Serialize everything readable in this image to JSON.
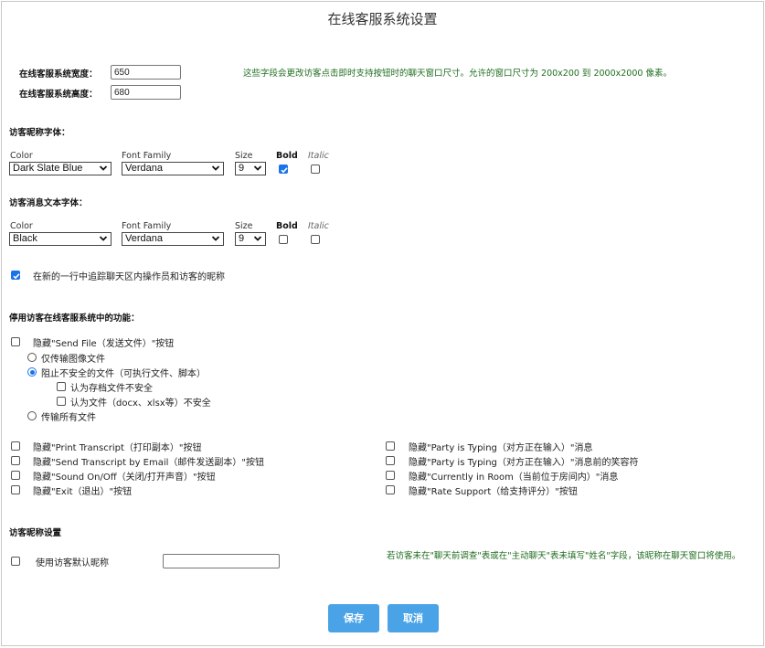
{
  "page": {
    "title": "在线客服系统设置"
  },
  "window_size": {
    "width_label": "在线客服系统宽度：",
    "width_value": "650",
    "height_label": "在线客服系统高度：",
    "height_value": "680",
    "hint": "这些字段会更改访客点击即时支持按钮时的聊天窗口尺寸。允许的窗口尺寸为 200x200 到 2000x2000 像素。"
  },
  "nickname_font": {
    "heading": "访客昵称字体：",
    "color_label": "Color",
    "color_value": "Dark Slate Blue",
    "family_label": "Font Family",
    "family_value": "Verdana",
    "size_label": "Size",
    "size_value": "9",
    "bold_label": "Bold",
    "bold_checked": true,
    "italic_label": "Italic",
    "italic_checked": false
  },
  "message_font": {
    "heading": "访客消息文本字体：",
    "color_label": "Color",
    "color_value": "Black",
    "family_label": "Font Family",
    "family_value": "Verdana",
    "size_label": "Size",
    "size_value": "9",
    "bold_label": "Bold",
    "bold_checked": false,
    "italic_label": "Italic",
    "italic_checked": false
  },
  "track_nicknames": {
    "label": "在新的一行中追踪聊天区内操作员和访客的昵称",
    "checked": true
  },
  "disable_features": {
    "heading": "停用访客在线客服系统中的功能：",
    "send_file": {
      "label": "隐藏\"Send File（发送文件）\"按钮",
      "checked": false,
      "options": [
        {
          "label": "仅传输图像文件",
          "selected": false
        },
        {
          "label": "阻止不安全的文件（可执行文件、脚本）",
          "selected": true
        },
        {
          "label": "传输所有文件",
          "selected": false
        }
      ],
      "sub_options": [
        {
          "label": "认为存档文件不安全",
          "checked": false
        },
        {
          "label": "认为文件（docx、xlsx等）不安全",
          "checked": false
        }
      ]
    },
    "left_items": [
      {
        "label": "隐藏\"Print Transcript（打印副本）\"按钮",
        "checked": false
      },
      {
        "label": "隐藏\"Send Transcript by Email（邮件发送副本）\"按钮",
        "checked": false
      },
      {
        "label": "隐藏\"Sound On/Off（关闭/打开声音）\"按钮",
        "checked": false
      },
      {
        "label": "隐藏\"Exit（退出）\"按钮",
        "checked": false
      }
    ],
    "right_items": [
      {
        "label": "隐藏\"Party is Typing（对方正在输入）\"消息",
        "checked": false
      },
      {
        "label": "隐藏\"Party is Typing（对方正在输入）\"消息前的笑容符",
        "checked": false
      },
      {
        "label": "隐藏\"Currently in Room（当前位于房间内）\"消息",
        "checked": false
      },
      {
        "label": "隐藏\"Rate Support（给支持评分）\"按钮",
        "checked": false
      }
    ]
  },
  "nickname_settings": {
    "heading": "访客昵称设置",
    "default_label": "使用访客默认昵称",
    "default_checked": false,
    "default_value": "",
    "hint": "若访客未在\"聊天前调查\"表或在\"主动聊天\"表未填写\"姓名\"字段，该昵称在聊天窗口将使用。"
  },
  "actions": {
    "save_label": "保存",
    "cancel_label": "取消"
  },
  "colors": {
    "accent": "#1a73e8",
    "button": "#4aa3e6",
    "hint_text": "#1f6d1f",
    "border": "#c8c8c8"
  }
}
